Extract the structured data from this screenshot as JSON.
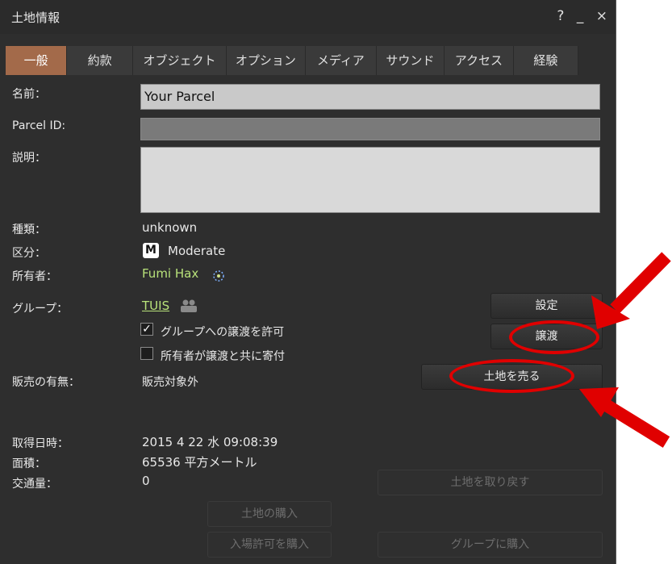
{
  "window": {
    "title": "土地情報",
    "help_icon": "?",
    "minimize_icon": "_",
    "close_icon": "×"
  },
  "tabs": [
    {
      "label": "一般",
      "active": true
    },
    {
      "label": "約款"
    },
    {
      "label": "オブジェクト"
    },
    {
      "label": "オプション"
    },
    {
      "label": "メディア"
    },
    {
      "label": "サウンド"
    },
    {
      "label": "アクセス"
    },
    {
      "label": "経験"
    }
  ],
  "general": {
    "name_label": "名前：",
    "name_value": "Your Parcel",
    "parcel_id_label": "Parcel ID:",
    "parcel_id_value": "",
    "description_label": "説明：",
    "description_value": "",
    "type_label": "種類：",
    "type_value": "unknown",
    "rating_label": "区分：",
    "rating_badge": "M",
    "rating_value": "Moderate",
    "owner_label": "所有者：",
    "owner_value": "Fumi Hax",
    "group_label": "グループ：",
    "group_value": "TUIS",
    "allow_deed_label": "グループへの譲渡を許可",
    "allow_deed_checked": true,
    "owner_contribute_label": "所有者が譲渡と共に寄付",
    "owner_contribute_checked": false,
    "for_sale_label": "販売の有無：",
    "for_sale_value": "販売対象外",
    "acquired_label": "取得日時：",
    "acquired_value": "2015 4 22 水 09:08:39",
    "area_label": "面積：",
    "area_value": "65536 平方メートル",
    "traffic_label": "交通量：",
    "traffic_value": "0"
  },
  "buttons": {
    "settings": "設定",
    "deed": "譲渡",
    "sell_land": "土地を売る",
    "reclaim_land": "土地を取り戻す",
    "buy_land": "土地の購入",
    "buy_pass": "入場許可を購入",
    "buy_for_group": "グループに購入"
  },
  "colors": {
    "annotation": "#e00000",
    "active_tab": "#a36a4a",
    "link": "#b8e27a"
  }
}
